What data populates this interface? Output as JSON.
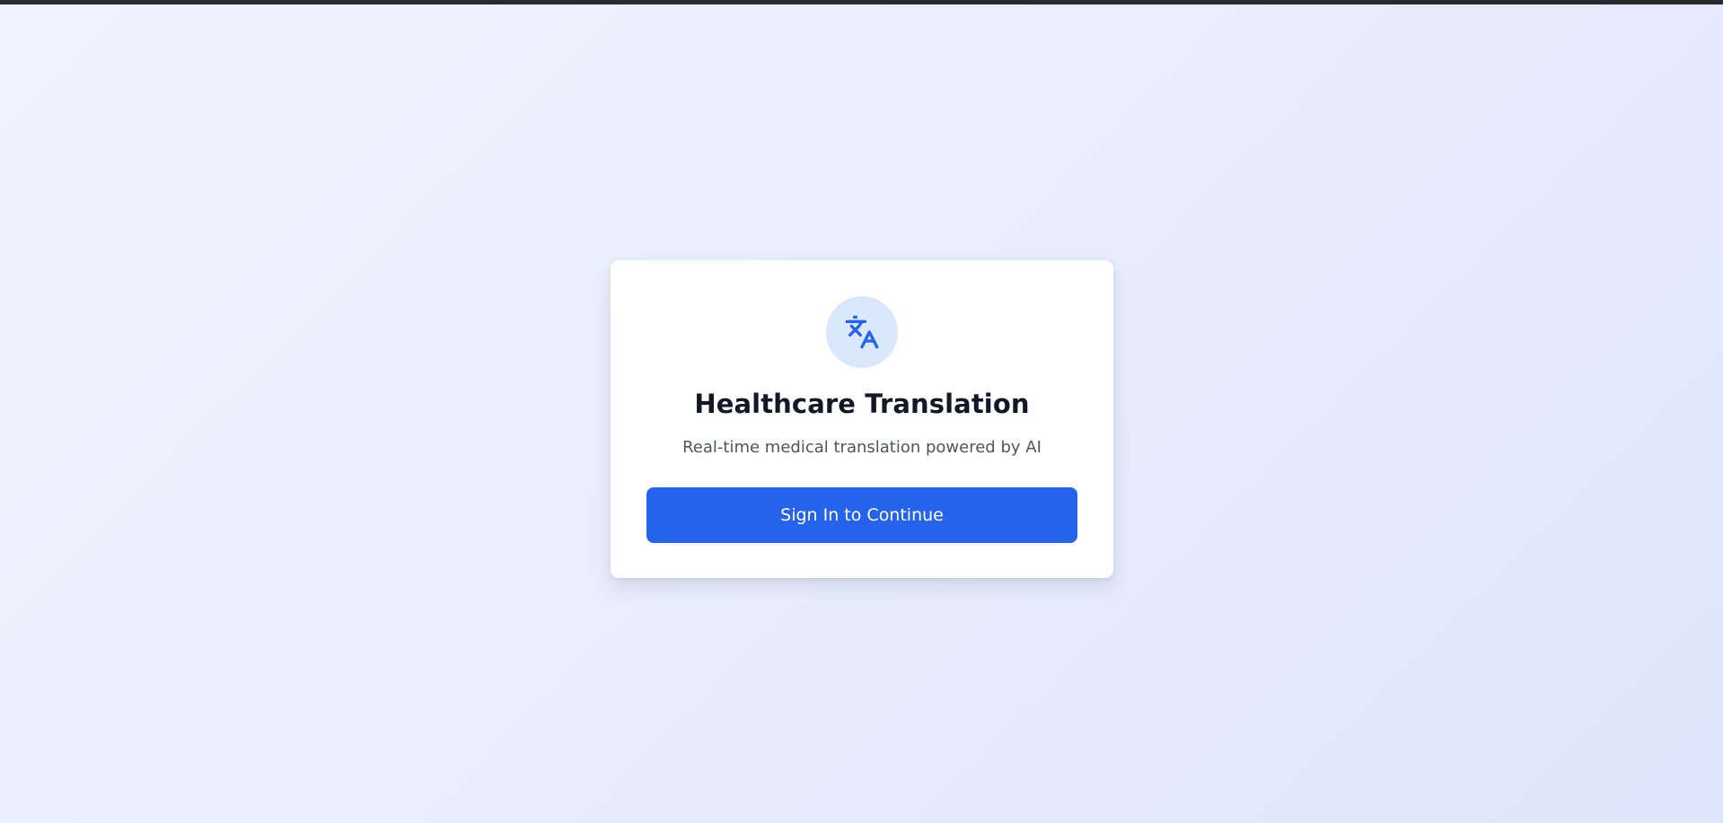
{
  "app": {
    "title": "Healthcare Translation",
    "subtitle": "Real-time medical translation powered by AI"
  },
  "icon": {
    "name": "translate-icon",
    "color": "#2563eb",
    "background": "#dbe7fd"
  },
  "actions": {
    "sign_in_label": "Sign In to Continue"
  },
  "colors": {
    "accent": "#2563eb",
    "title": "#111827",
    "subtitle": "#4b5563",
    "card": "#ffffff",
    "page_background": "#e8eefc"
  }
}
